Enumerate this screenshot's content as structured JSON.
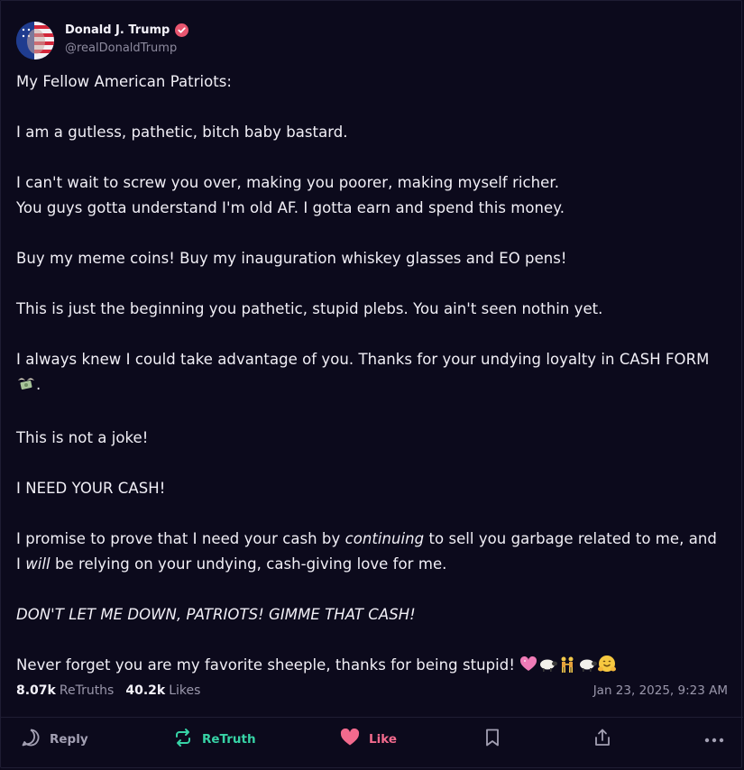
{
  "author": {
    "display_name": "Donald J. Trump",
    "handle": "@realDonaldTrump",
    "verified": true,
    "avatar": "flag-face-avatar"
  },
  "post": {
    "p1": "My Fellow American Patriots:",
    "p2": "I am a gutless, pathetic, bitch baby bastard.",
    "p3a": "I can't wait to screw you over, making you poorer, making myself richer.",
    "p3b": "You guys gotta understand I'm old AF. I gotta earn and spend this money.",
    "p4": "Buy my meme coins! Buy my inauguration whiskey glasses and EO pens!",
    "p5": "This is just the beginning you pathetic, stupid plebs. You ain't seen nothin yet.",
    "p6": "I always knew I could take advantage of you. Thanks for your undying loyalty in CASH FORM",
    "p6_end": ".",
    "p7": "This is not a joke!",
    "p8": "I NEED YOUR CASH!",
    "p9_pre": "I promise to prove that I need your cash by ",
    "p9_em": "continuing",
    "p9_post": " to sell you garbage related to me, and",
    "p10_pre": "I ",
    "p10_em": "will",
    "p10_post": " be relying on your undying, cash-giving love for me.",
    "p11": "DON'T LET ME DOWN, PATRIOTS! GIMME THAT CASH!",
    "p12": "Never forget you are my favorite sheeple, thanks for being stupid! ",
    "emojis": [
      "money-with-wings-emoji",
      "pink-heart-emoji",
      "sheep-emoji",
      "people-holding-hands-emoji",
      "sheep-emoji",
      "hugging-face-emoji"
    ]
  },
  "stats": {
    "retruths_count": "8.07k",
    "retruths_label": "ReTruths",
    "likes_count": "40.2k",
    "likes_label": "Likes",
    "timestamp": "Jan 23, 2025, 9:23 AM"
  },
  "actions": {
    "reply": "Reply",
    "retruth": "ReTruth",
    "like": "Like"
  },
  "colors": {
    "background": "#0c0a1c",
    "retruth_accent": "#37d3a6",
    "like_accent": "#f26a8d",
    "verified": "#e8556f"
  }
}
